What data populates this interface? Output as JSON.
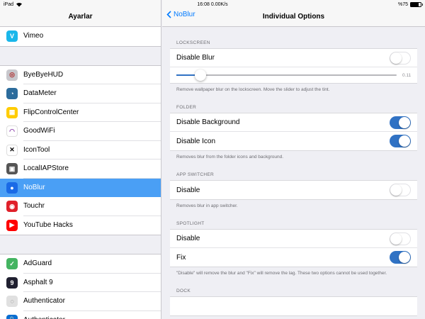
{
  "status": {
    "carrier": "iPad",
    "center": "16:08 0.00K/s",
    "battery": "%75",
    "battery_level": 0.75
  },
  "sidebar": {
    "title": "Ayarlar",
    "groups": [
      [
        {
          "label": "Vimeo",
          "icon": "vimeo-icon",
          "color": "#1ab7ea"
        }
      ],
      [
        {
          "label": "ByeByeHUD",
          "icon": "byebyehud-icon",
          "color": "#c7c7cc"
        },
        {
          "label": "DataMeter",
          "icon": "datameter-icon",
          "color": "#2c6c9c"
        },
        {
          "label": "FlipControlCenter",
          "icon": "flipcontrolcenter-icon",
          "color": "#ffcc00"
        },
        {
          "label": "GoodWiFi",
          "icon": "wifi-icon",
          "color": "#ffffff"
        },
        {
          "label": "IconTool",
          "icon": "hammer-wrench-icon",
          "color": "#ffffff"
        },
        {
          "label": "LocalIAPStore",
          "icon": "localiapstore-icon",
          "color": "#555555"
        },
        {
          "label": "NoBlur",
          "icon": "noblur-icon",
          "color": "#1a6ae6"
        },
        {
          "label": "Touchr",
          "icon": "touchr-icon",
          "color": "#e0202a"
        },
        {
          "label": "YouTube Hacks",
          "icon": "youtube-icon",
          "color": "#ff0000"
        }
      ],
      [
        {
          "label": "AdGuard",
          "icon": "adguard-icon",
          "color": "#44b461"
        },
        {
          "label": "Asphalt 9",
          "icon": "asphalt9-icon",
          "color": "#202030"
        },
        {
          "label": "Authenticator",
          "icon": "authenticator-icon",
          "color": "#e0e0e0"
        },
        {
          "label": "Authenticator",
          "icon": "authenticator-lock-icon",
          "color": "#0a6ed1"
        }
      ]
    ],
    "selected": "NoBlur"
  },
  "nav": {
    "back_label": "NoBlur",
    "title": "Individual Options"
  },
  "sections": {
    "lockscreen": {
      "header": "LOCKSCREEN",
      "disable_blur": {
        "label": "Disable Blur",
        "on": false
      },
      "slider_value": "0.11",
      "slider_fraction": 0.11,
      "footer": "Remove wallpaper blur on the lockscreen.  Move the slider to adjust the tint."
    },
    "folder": {
      "header": "FOLDER",
      "disable_background": {
        "label": "Disable Background",
        "on": true
      },
      "disable_icon": {
        "label": "Disable Icon",
        "on": true
      },
      "footer": "Removes blur from the folder icons and background."
    },
    "app_switcher": {
      "header": "APP SWITCHER",
      "disable": {
        "label": "Disable",
        "on": false
      },
      "footer": "Removes blur in app switcher."
    },
    "spotlight": {
      "header": "SPOTLIGHT",
      "disable": {
        "label": "Disable",
        "on": false
      },
      "fix": {
        "label": "Fix",
        "on": true
      },
      "footer": "\"Disable\" will remove the blur and \"Fix\" will remove the lag.  These two options cannot be used together."
    },
    "dock": {
      "header": "DOCK"
    }
  },
  "colors": {
    "accent": "#007aff",
    "switch_on": "#3072c4",
    "selected_row": "#4a9ff5"
  }
}
